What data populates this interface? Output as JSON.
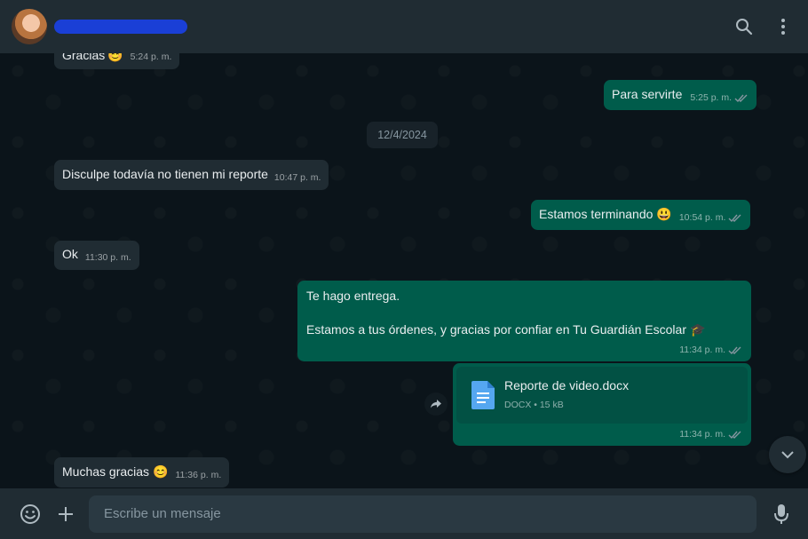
{
  "header": {
    "contact_name": "",
    "icons": [
      "search-icon",
      "menu-icon"
    ]
  },
  "chat": {
    "date_separator": "12/4/2024",
    "messages": [
      {
        "direction": "in",
        "text": "Gracias",
        "emoji": "😊",
        "time": "5:24 p. m."
      },
      {
        "direction": "out",
        "text": "Para servirte",
        "time": "5:25 p. m.",
        "status": "delivered"
      },
      {
        "direction": "in",
        "text": "Disculpe todavía no tienen mi reporte",
        "time": "10:47 p. m."
      },
      {
        "direction": "out",
        "text": "Estamos terminando",
        "emoji": "😃",
        "time": "10:54 p. m.",
        "status": "delivered"
      },
      {
        "direction": "in",
        "text": "Ok",
        "time": "11:30 p. m."
      },
      {
        "direction": "out",
        "line1": "Te hago entrega.",
        "line2": "Estamos a tus órdenes, y gracias por confiar en Tu Guardián Escolar",
        "emoji": "🎓",
        "time": "11:34 p. m.",
        "status": "delivered"
      },
      {
        "direction": "out",
        "type": "document",
        "file_name": "Reporte de video.docx",
        "file_info": "DOCX • 15 kB",
        "time": "11:34 p. m.",
        "status": "delivered"
      },
      {
        "direction": "in",
        "text": "Muchas gracias",
        "emoji": "😊",
        "time": "11:36 p. m."
      }
    ]
  },
  "composer": {
    "placeholder": "Escribe un mensaje",
    "icons": [
      "emoji-icon",
      "attach-icon",
      "microphone-icon"
    ]
  },
  "colors": {
    "header_bg": "#202c33",
    "chat_bg": "#0b141a",
    "incoming_bubble": "#202c33",
    "outgoing_bubble": "#005c4b",
    "read_tick": "#8696a0"
  }
}
